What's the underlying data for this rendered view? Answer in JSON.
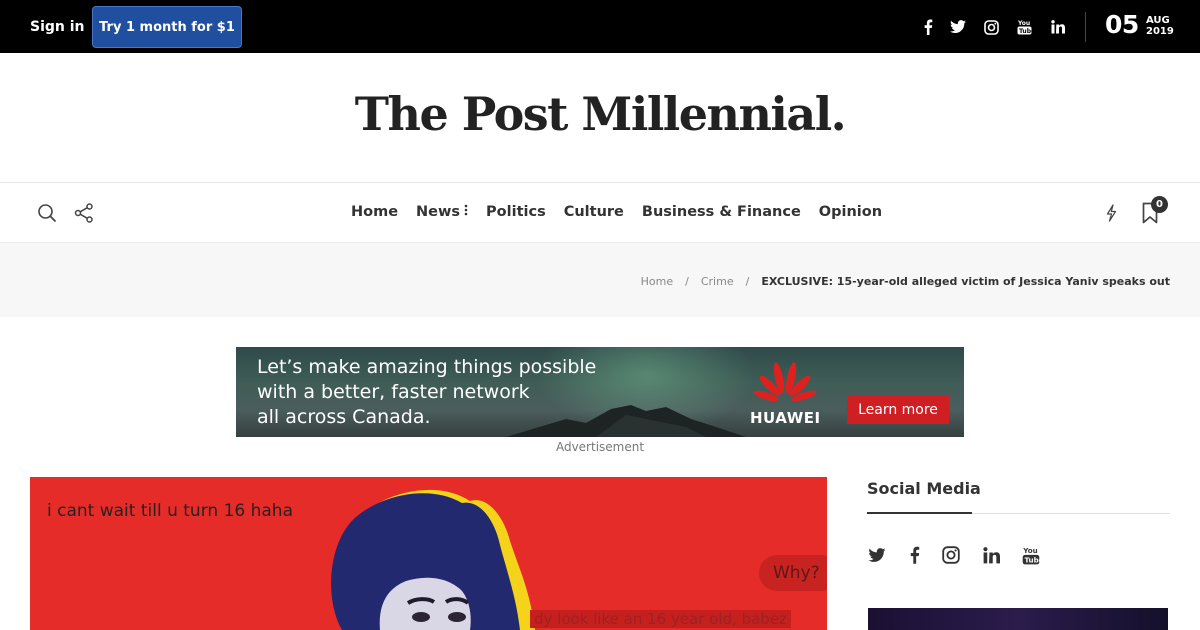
{
  "topbar": {
    "sign_in": "Sign in",
    "trial_button": "Try 1 month for $1",
    "social_icons": [
      "facebook-icon",
      "twitter-icon",
      "instagram-icon",
      "youtube-icon",
      "linkedin-icon"
    ],
    "date_day": "05",
    "date_month": "AUG",
    "date_year": "2019"
  },
  "masthead": {
    "logo": "The Post Millennial."
  },
  "nav": {
    "items": [
      "Home",
      "News",
      "Politics",
      "Culture",
      "Business & Finance",
      "Opinion"
    ],
    "bookmark_count": "0"
  },
  "breadcrumb": {
    "home": "Home",
    "separator": "/",
    "category": "Crime",
    "current": "EXCLUSIVE: 15-year-old alleged victim of Jessica Yaniv speaks out"
  },
  "ad": {
    "line1": "Let’s make amazing things possible",
    "line2": "with a better, faster network",
    "line3": "all across Canada.",
    "brand": "HUAWEI",
    "cta": "Learn more",
    "label": "Advertisement"
  },
  "hero": {
    "caption1": "i cant wait till u turn 16 haha",
    "bubble": "Why?",
    "caption2": "dy look like an 16 year old, babez"
  },
  "sidebar": {
    "title": "Social Media",
    "social_icons": [
      "twitter-icon",
      "facebook-icon",
      "instagram-icon",
      "linkedin-icon",
      "youtube-icon"
    ]
  },
  "colors": {
    "topbar_bg": "#000000",
    "trial_button_bg": "#1f4f9e",
    "hero_red": "#e52c28",
    "huawei_red": "#cf1f22"
  }
}
